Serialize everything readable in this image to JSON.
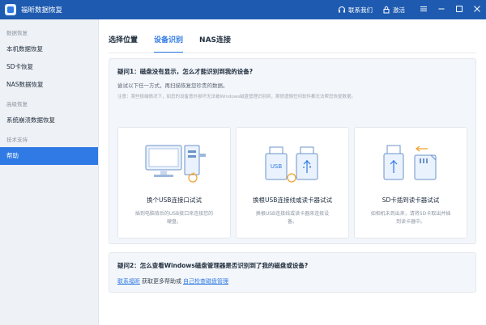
{
  "app": {
    "title": "福昕数据恢复"
  },
  "titlebar": {
    "contact_label": "联系我们",
    "activate_label": "激活",
    "icons": [
      "headset-icon",
      "lock-icon",
      "menu-icon",
      "minimize-icon",
      "maximize-icon",
      "close-icon"
    ]
  },
  "sidebar": {
    "sections": [
      {
        "label": "数据恢复",
        "items": [
          {
            "label": "本机数据恢复"
          },
          {
            "label": "SD卡恢复"
          },
          {
            "label": "NAS数据恢复"
          }
        ]
      },
      {
        "label": "高级恢复",
        "items": [
          {
            "label": "系统崩溃数据恢复"
          }
        ]
      },
      {
        "label": "技术支持",
        "items": [
          {
            "label": "帮助",
            "active": true
          }
        ]
      }
    ]
  },
  "main": {
    "tabs": [
      {
        "label": "选择位置"
      },
      {
        "label": "设备识别",
        "active": true
      },
      {
        "label": "NAS连接"
      }
    ],
    "question1": {
      "title": "疑问1：磁盘没有显示，怎么才能识别到我的设备?",
      "desc": "尝试以下任一方式，再扫描恢复您珍贵的数据。",
      "note": "注意：某些极端情况下，如您的设备意外损坏无法被Windows磁盘管理识别到，那很遗憾任何软件都无法帮您恢复数据。",
      "options": [
        {
          "title": "换个USB连接口试试",
          "desc": "插到电脑背后的USB接口来连接您的硬盘。",
          "icon": "pc-usb-port-icon"
        },
        {
          "title": "换根USB连接线或读卡器试试",
          "desc": "换根USB连接线或读卡器来连接设备。",
          "icon": "usb-cable-icon"
        },
        {
          "title": "SD卡插到读卡器试试",
          "desc": "如相机未到出来，请将SD卡取出并插到读卡器中。",
          "icon": "sd-card-reader-icon"
        }
      ]
    },
    "question2": {
      "title": "疑问2：怎么查看Windows磁盘管理器是否识别到了我的磁盘或设备?",
      "contact_link": "联系福昕",
      "middle_text": "获取更多帮助或",
      "check_link": "自己检查磁盘管理"
    }
  },
  "colors": {
    "accent": "#2f7ae5",
    "titlebar": "#1e5bb0"
  }
}
